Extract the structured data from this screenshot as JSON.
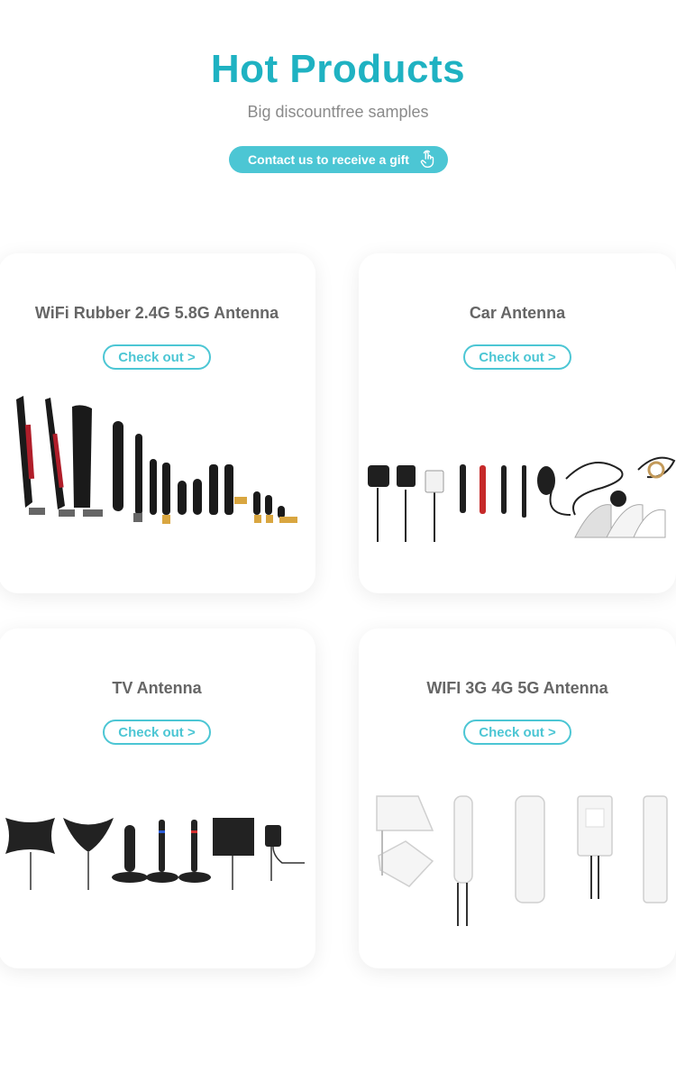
{
  "header": {
    "title": "Hot Products",
    "subtitle": "Big discountfree samples",
    "cta_label": "Contact us to receive a gift",
    "cta_icon": "hand-pointer-icon"
  },
  "cards": [
    {
      "title": "WiFi Rubber 2.4G 5.8G Antenna",
      "button": "Check out >"
    },
    {
      "title": "Car Antenna",
      "button": "Check out >"
    },
    {
      "title": "TV Antenna",
      "button": "Check out >"
    },
    {
      "title": "WIFI 3G 4G 5G Antenna",
      "button": "Check out >"
    }
  ],
  "colors": {
    "accent": "#1fb2c2",
    "button": "#4cc6d4",
    "text": "#666666"
  }
}
